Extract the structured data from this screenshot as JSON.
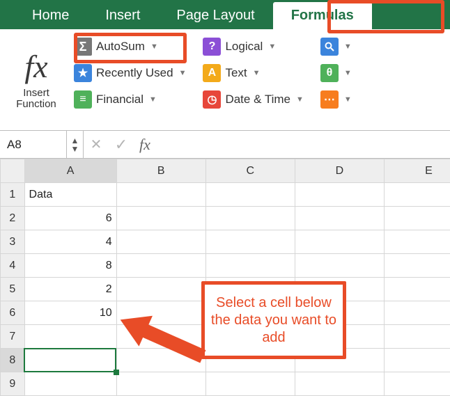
{
  "ribbon": {
    "tabs": [
      "Home",
      "Insert",
      "Page Layout",
      "Formulas"
    ],
    "active_tab_index": 3,
    "insert_function_label": "Insert Function",
    "buttons": {
      "autosum": "AutoSum",
      "recently_used": "Recently Used",
      "financial": "Financial",
      "logical": "Logical",
      "text": "Text",
      "date_time": "Date & Time"
    }
  },
  "formula_bar": {
    "name_box": "A8",
    "formula": ""
  },
  "grid": {
    "columns": [
      "A",
      "B",
      "C",
      "D",
      "E"
    ],
    "row_count": 9,
    "selected_cell": "A8"
  },
  "chart_data": {
    "type": "table",
    "columns": [
      "A"
    ],
    "rows": [
      {
        "row": 1,
        "A": "Data"
      },
      {
        "row": 2,
        "A": 6
      },
      {
        "row": 3,
        "A": 4
      },
      {
        "row": 4,
        "A": 8
      },
      {
        "row": 5,
        "A": 2
      },
      {
        "row": 6,
        "A": 10
      },
      {
        "row": 7,
        "A": ""
      },
      {
        "row": 8,
        "A": ""
      },
      {
        "row": 9,
        "A": ""
      }
    ]
  },
  "annotation": {
    "callout_text": "Select a cell below the data you want to add"
  }
}
